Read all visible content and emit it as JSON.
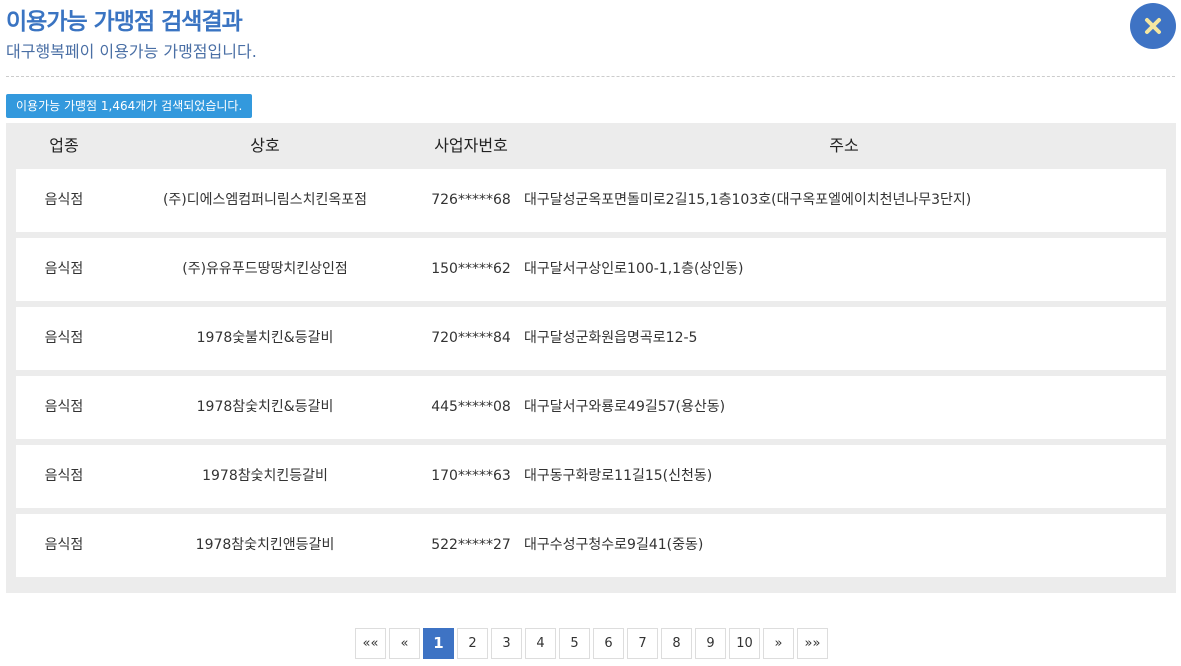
{
  "header": {
    "title": "이용가능 가맹점 검색결과",
    "subtitle": "대구행복페이 이용가능 가맹점입니다."
  },
  "close_button": {
    "icon": "close-icon"
  },
  "result_count": "이용가능 가맹점 1,464개가 검색되었습니다.",
  "table": {
    "headers": [
      "업종",
      "상호",
      "사업자번호",
      "주소"
    ],
    "rows": [
      {
        "category": "음식점",
        "name": "(주)디에스엠컴퍼니림스치킨옥포점",
        "biz_no": "726*****68",
        "address": "대구달성군옥포면돌미로2길15,1층103호(대구옥포엘에이치천년나무3단지)"
      },
      {
        "category": "음식점",
        "name": "(주)유유푸드땅땅치킨상인점",
        "biz_no": "150*****62",
        "address": "대구달서구상인로100-1,1층(상인동)"
      },
      {
        "category": "음식점",
        "name": "1978숯불치킨&등갈비",
        "biz_no": "720*****84",
        "address": "대구달성군화원읍명곡로12-5"
      },
      {
        "category": "음식점",
        "name": "1978참숯치킨&등갈비",
        "biz_no": "445*****08",
        "address": "대구달서구와룡로49길57(용산동)"
      },
      {
        "category": "음식점",
        "name": "1978참숯치킨등갈비",
        "biz_no": "170*****63",
        "address": "대구동구화랑로11길15(신천동)"
      },
      {
        "category": "음식점",
        "name": "1978참숯치킨앤등갈비",
        "biz_no": "522*****27",
        "address": "대구수성구청수로9길41(중동)"
      }
    ]
  },
  "pagination": {
    "first": "««",
    "prev": "«",
    "pages": [
      "1",
      "2",
      "3",
      "4",
      "5",
      "6",
      "7",
      "8",
      "9",
      "10"
    ],
    "current": "1",
    "next": "»",
    "last": "»»"
  },
  "colors": {
    "accent": "#3e73c4",
    "badge": "#3399dd",
    "table_bg": "#ececec"
  }
}
